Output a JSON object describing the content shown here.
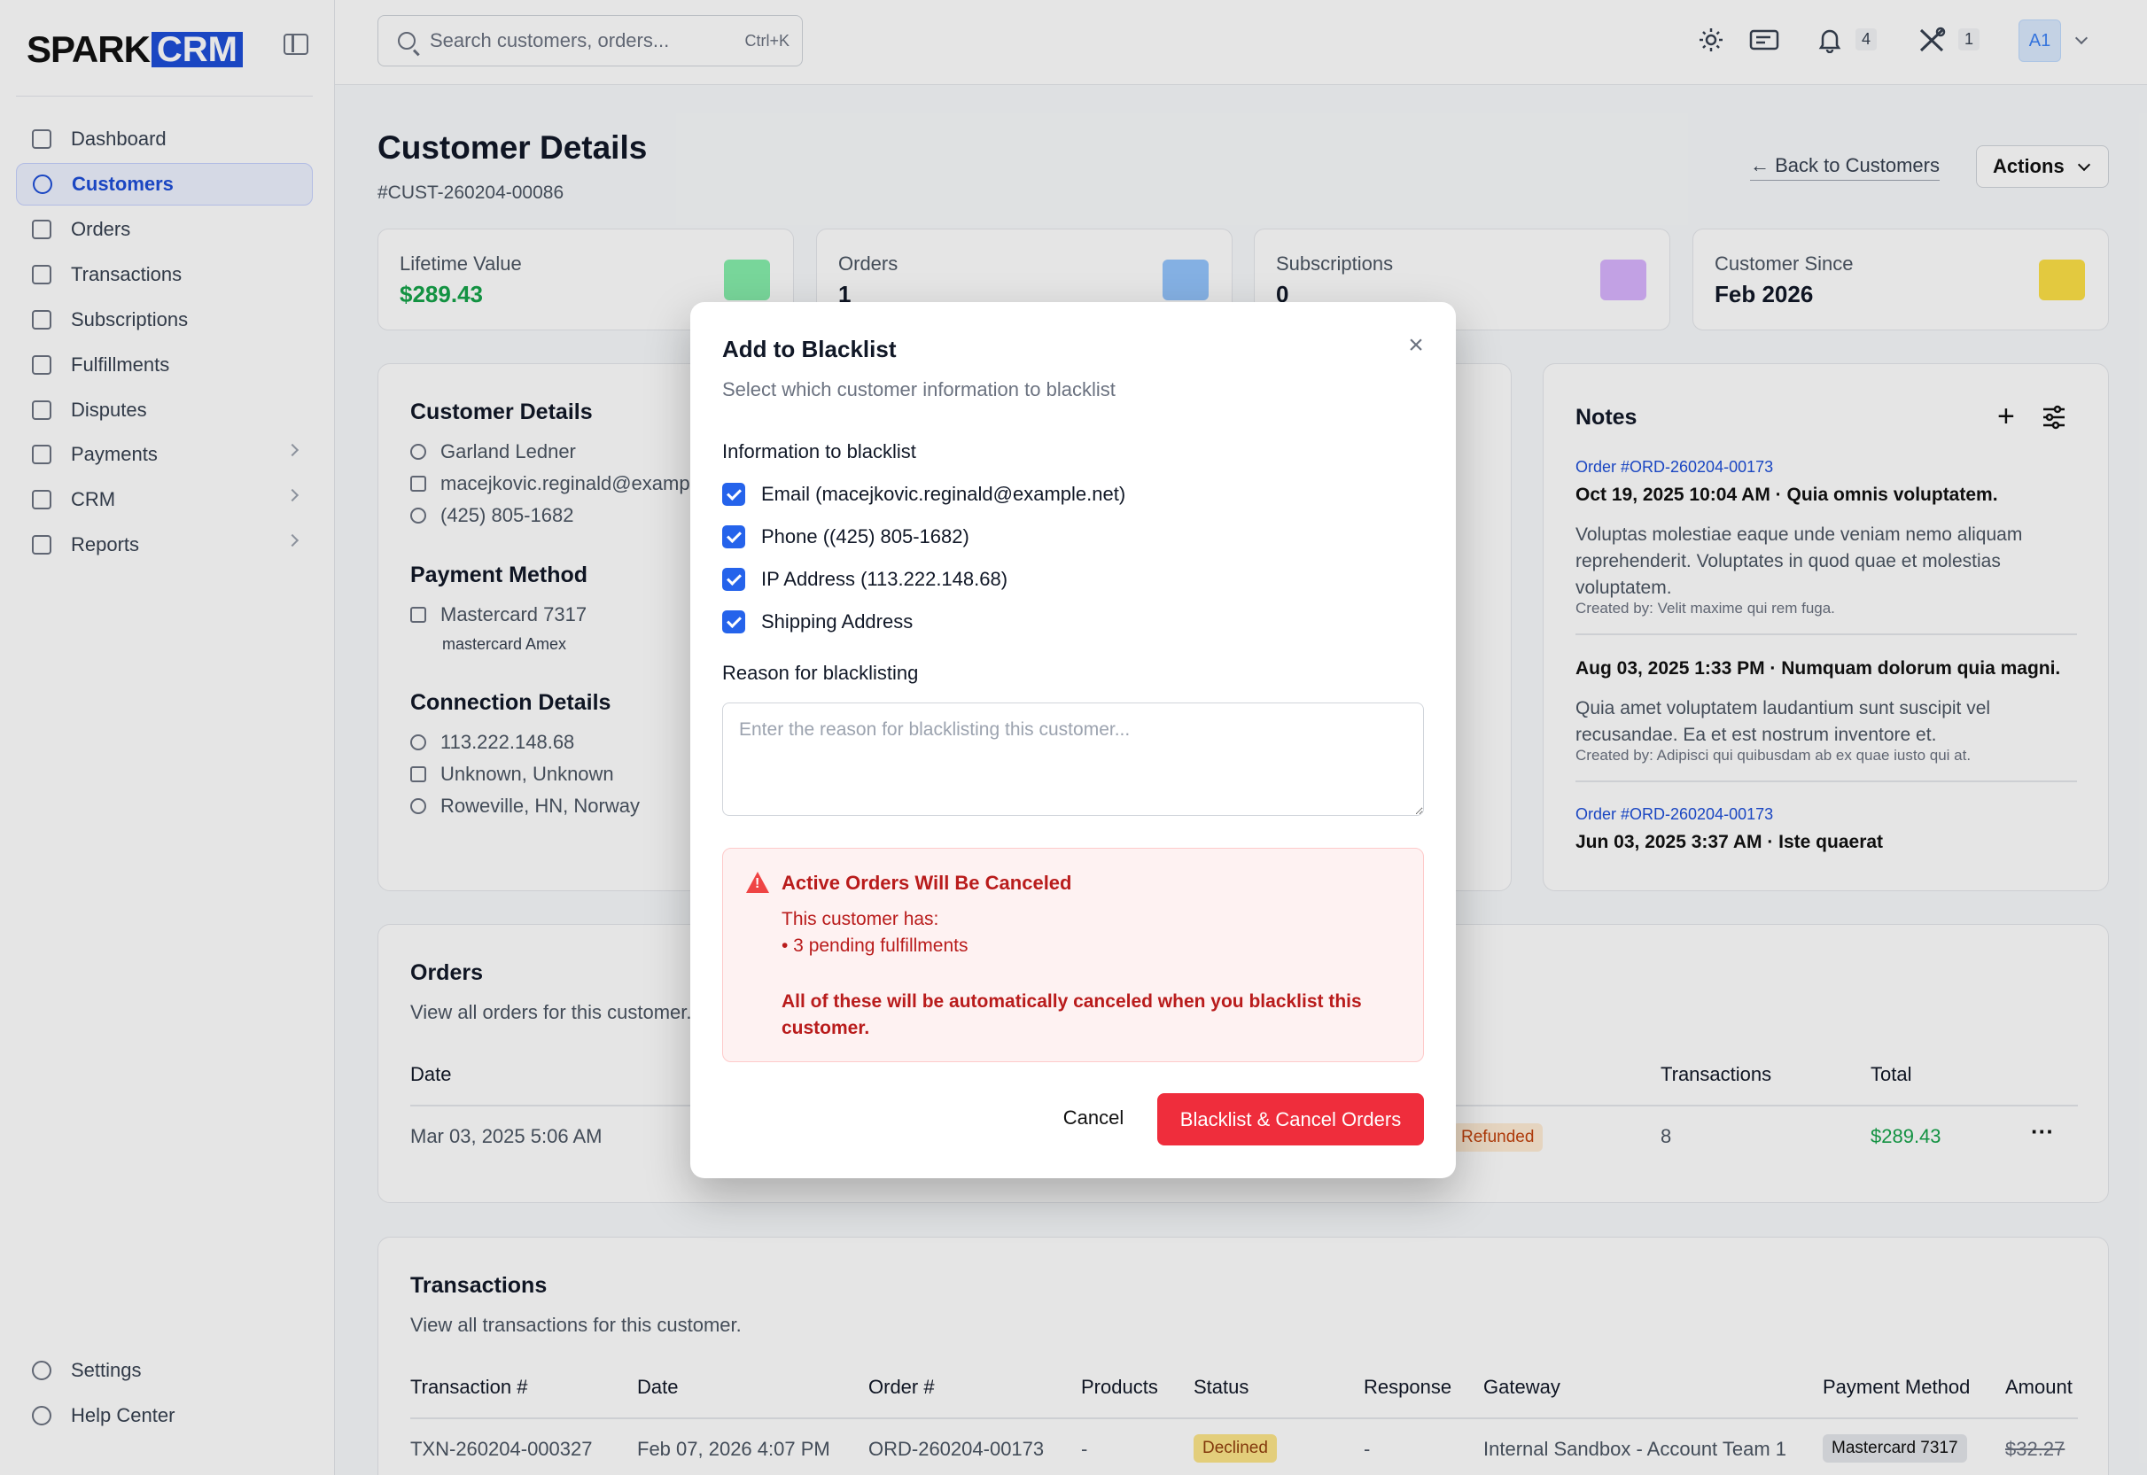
{
  "brand": {
    "part1": "SPARK",
    "part2": "CRM"
  },
  "nav": [
    {
      "label": "Dashboard",
      "icon": "home-icon",
      "name": "dashboard"
    },
    {
      "label": "Customers",
      "icon": "users-icon",
      "name": "customers",
      "active": true
    },
    {
      "label": "Orders",
      "icon": "file-icon",
      "name": "orders"
    },
    {
      "label": "Transactions",
      "icon": "card-icon",
      "name": "transactions"
    },
    {
      "label": "Subscriptions",
      "icon": "refresh-icon",
      "name": "subscriptions"
    },
    {
      "label": "Fulfillments",
      "icon": "box-icon",
      "name": "fulfillments"
    },
    {
      "label": "Disputes",
      "icon": "shield-icon",
      "name": "disputes"
    },
    {
      "label": "Payments",
      "icon": "dollar-icon",
      "name": "payments",
      "chevron": true
    },
    {
      "label": "CRM",
      "icon": "building-icon",
      "name": "crm",
      "chevron": true
    },
    {
      "label": "Reports",
      "icon": "report-icon",
      "name": "reports",
      "chevron": true
    }
  ],
  "nav_bottom": [
    {
      "label": "Settings",
      "icon": "gear-icon",
      "name": "settings"
    },
    {
      "label": "Help Center",
      "icon": "help-icon",
      "name": "help-center"
    }
  ],
  "header": {
    "search_placeholder": "Search customers, orders...",
    "search_shortcut": "Ctrl+K",
    "notifications_count": "4",
    "tools_count": "1",
    "avatar": "A1"
  },
  "page": {
    "title": "Customer Details",
    "id": "#CUST-260204-00086",
    "back": "Back to Customers",
    "actions": "Actions"
  },
  "stats": [
    {
      "label": "Lifetime Value",
      "value": "$289.43",
      "color": "#16a34a",
      "icon": "money-icon",
      "icon_color": "#86efac"
    },
    {
      "label": "Orders",
      "value": "1",
      "color": "#111827",
      "icon": "shopping-bag-icon",
      "icon_color": "#93c5fd"
    },
    {
      "label": "Subscriptions",
      "value": "0",
      "color": "#111827",
      "icon": "refresh-icon",
      "icon_color": "#d8b4fe"
    },
    {
      "label": "Customer Since",
      "value": "Feb 2026",
      "color": "#111827",
      "icon": "calendar-icon",
      "icon_color": "#fde047"
    }
  ],
  "customer": {
    "section": "Customer Details",
    "name": "Garland Ledner",
    "email": "macejkovic.reginald@example.net",
    "phone": "(425) 805-1682",
    "payment_section": "Payment Method",
    "card": "Mastercard 7317",
    "card_sub": "mastercard Amex",
    "connection_section": "Connection Details",
    "ip": "113.222.148.68",
    "device": "Unknown, Unknown",
    "location": "Roweville, HN, Norway"
  },
  "notes": {
    "title": "Notes",
    "items": [
      {
        "link": "Order #ORD-260204-00173",
        "heading": "Oct 19, 2025 10:04 AM · Quia omnis voluptatem.",
        "body": "Voluptas molestiae eaque unde veniam nemo aliquam reprehenderit. Voluptates in quod quae et molestias voluptatem.",
        "created": "Created by: Velit maxime qui rem fuga."
      },
      {
        "link": "",
        "heading": "Aug 03, 2025 1:33 PM · Numquam dolorum quia magni.",
        "body": "Quia amet voluptatem laudantium sunt suscipit vel recusandae. Ea et est nostrum inventore et.",
        "created": "Created by: Adipisci qui quibusdam ab ex quae iusto qui at."
      },
      {
        "link": "Order #ORD-260204-00173",
        "heading": "Jun 03, 2025 3:37 AM · Iste quaerat",
        "body": "",
        "created": ""
      }
    ]
  },
  "orders": {
    "title": "Orders",
    "subtitle": "View all orders for this customer.",
    "headers": {
      "date": "Date",
      "transactions": "Transactions",
      "total": "Total"
    },
    "rows": [
      {
        "date": "Mar 03, 2025 5:06 AM",
        "status": "Refunded",
        "transactions": "8",
        "total": "$289.43"
      }
    ]
  },
  "transactions": {
    "title": "Transactions",
    "subtitle": "View all transactions for this customer.",
    "headers": [
      "Transaction #",
      "Date",
      "Order #",
      "Products",
      "Status",
      "Response",
      "Gateway",
      "Payment Method",
      "Amount"
    ],
    "rows": [
      {
        "id": "TXN-260204-000327",
        "date": "Feb 07, 2026 4:07 PM",
        "order": "ORD-260204-00173",
        "products": "-",
        "status": "Declined",
        "response": "-",
        "gateway": "Internal Sandbox - Account Team 1",
        "method": "Mastercard 7317",
        "amount": "$32.27"
      }
    ]
  },
  "modal": {
    "title": "Add to Blacklist",
    "subtitle": "Select which customer information to blacklist",
    "info_label": "Information to blacklist",
    "checks": [
      "Email (macejkovic.reginald@example.net)",
      "Phone ((425) 805-1682)",
      "IP Address (113.222.148.68)",
      "Shipping Address"
    ],
    "reason_label": "Reason for blacklisting",
    "reason_placeholder": "Enter the reason for blacklisting this customer...",
    "alert": {
      "title": "Active Orders Will Be Canceled",
      "has": "This customer has:",
      "item": "• 3 pending fulfillments",
      "warning": "All of these will be automatically canceled when you blacklist this customer."
    },
    "cancel": "Cancel",
    "confirm": "Blacklist & Cancel Orders"
  }
}
